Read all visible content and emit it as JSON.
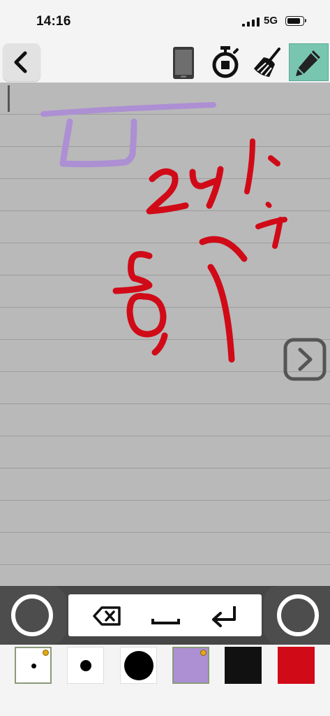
{
  "status_bar": {
    "time": "14:16",
    "network": "5G"
  },
  "toolbar": {
    "buttons": [
      {
        "name": "back",
        "icon": "chevron-left-icon"
      },
      {
        "name": "phone",
        "icon": "phone-icon"
      },
      {
        "name": "timer",
        "icon": "stopwatch-icon"
      },
      {
        "name": "clear",
        "icon": "broom-icon"
      },
      {
        "name": "pen",
        "icon": "pencil-icon",
        "active": true
      }
    ]
  },
  "canvas": {
    "background": "#b9b9b9",
    "line_color": "#9c9c9c",
    "ink_colors": [
      "#ad8fd4",
      "#d10a18"
    ]
  },
  "keyboard": {
    "keys": [
      {
        "name": "backspace",
        "icon": "backspace-icon"
      },
      {
        "name": "space",
        "icon": "space-icon"
      },
      {
        "name": "enter",
        "icon": "return-icon"
      }
    ]
  },
  "palette": {
    "brush_sizes": [
      "small",
      "medium",
      "large"
    ],
    "selected_brush": "small",
    "colors": [
      "#ad8fd4",
      "#111111",
      "#d10a18"
    ],
    "selected_color": "#ad8fd4"
  }
}
